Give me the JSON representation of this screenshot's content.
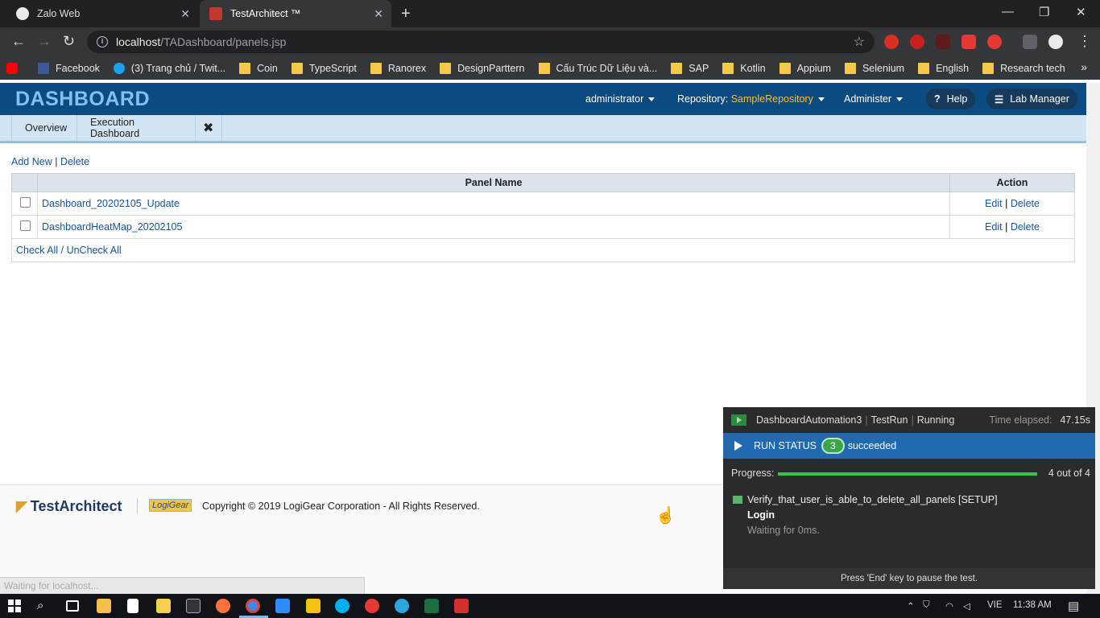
{
  "browser": {
    "tabs": [
      {
        "title": "Zalo Web",
        "active": false
      },
      {
        "title": "TestArchitect ™",
        "active": true
      }
    ],
    "url_host": "localhost",
    "url_path": "/TADashboard/panels.jsp",
    "bookmarks": [
      {
        "label": "Facebook",
        "icon": "facebook-icon"
      },
      {
        "label": "(3) Trang chủ / Twit...",
        "icon": "twitter-icon"
      },
      {
        "label": "Coin",
        "icon": "folder-icon"
      },
      {
        "label": "TypeScript",
        "icon": "folder-icon"
      },
      {
        "label": "Ranorex",
        "icon": "folder-icon"
      },
      {
        "label": "DesignParttern",
        "icon": "folder-icon"
      },
      {
        "label": "Cấu Trúc Dữ Liệu và...",
        "icon": "folder-icon"
      },
      {
        "label": "SAP",
        "icon": "folder-icon"
      },
      {
        "label": "Kotlin",
        "icon": "folder-icon"
      },
      {
        "label": "Appium",
        "icon": "folder-icon"
      },
      {
        "label": "Selenium",
        "icon": "folder-icon"
      },
      {
        "label": "English",
        "icon": "folder-icon"
      },
      {
        "label": "Research tech",
        "icon": "folder-icon"
      }
    ]
  },
  "header": {
    "logo": "DASHBOARD",
    "user": "administrator",
    "repo_label": "Repository:",
    "repo_value": "SampleRepository",
    "administer": "Administer",
    "help": "Help",
    "lab_manager": "Lab Manager"
  },
  "nav": {
    "tabs": [
      "Overview",
      "Execution Dashboard"
    ],
    "settings_icon": "wrench-icon"
  },
  "panels": {
    "add_new": "Add New",
    "separator": "|",
    "delete": "Delete",
    "columns": {
      "name": "Panel Name",
      "action": "Action"
    },
    "rows": [
      {
        "name": "Dashboard_20202105_Update",
        "edit": "Edit",
        "sep": "|",
        "delete": "Delete"
      },
      {
        "name": "DashboardHeatMap_20202105",
        "edit": "Edit",
        "sep": "|",
        "delete": "Delete"
      }
    ],
    "check_all": "Check All",
    "slash": "/",
    "uncheck_all": "UnCheck All"
  },
  "footer": {
    "brand": "TestArchitect",
    "partner": "LogiGear",
    "copyright": "Copyright © 2019 LogiGear Corporation - All Rights Reserved."
  },
  "status_text": "Waiting for localhost...",
  "run_panel": {
    "name": "DashboardAutomation3",
    "kind": "TestRun",
    "state": "Running",
    "elapsed_label": "Time elapsed:",
    "elapsed": "47.15s",
    "status_label": "RUN STATUS",
    "succeeded_count": "3",
    "succeeded_label": "succeeded",
    "progress_label": "Progress:",
    "progress_fraction": 1.0,
    "progress_text": "4 out of 4",
    "step": "Verify_that_user_is_able_to_delete_all_panels [SETUP]",
    "action": "Login",
    "waiting": "Waiting for 0ms.",
    "footer": "Press 'End' key to pause the test."
  },
  "taskbar": {
    "lang": "VIE",
    "time": "11:38 AM"
  },
  "colors": {
    "header_bg": "#0c4a82",
    "repo_accent": "#f6c02f",
    "run_status_bg": "#1f6ab0",
    "progress_fill": "#36c24e"
  }
}
